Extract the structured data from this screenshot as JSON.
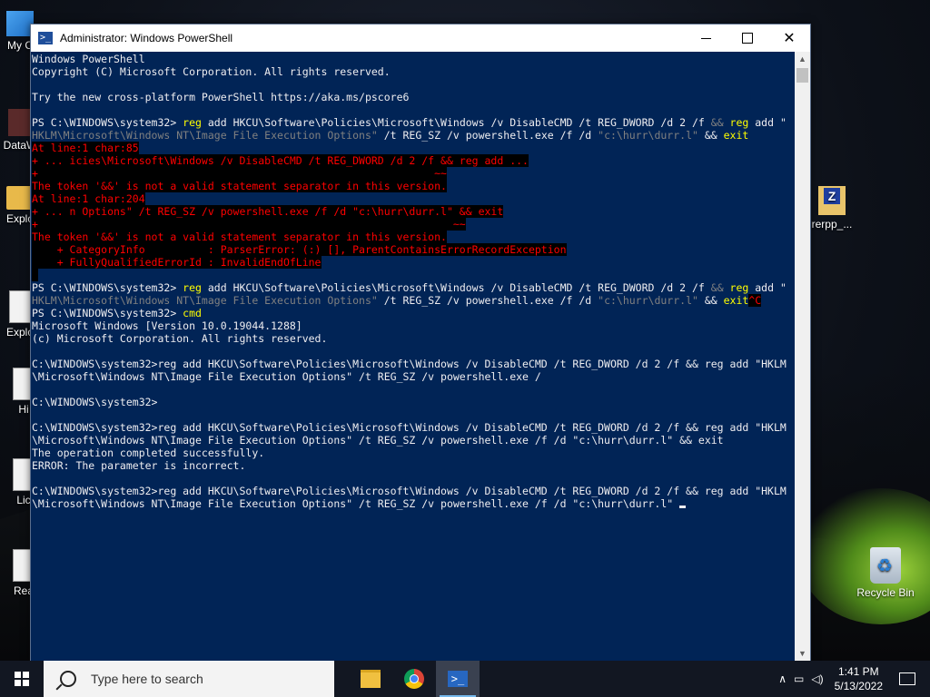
{
  "window": {
    "title": "Administrator: Windows PowerShell",
    "icon": "powershell-icon"
  },
  "console": {
    "lines": [
      [
        {
          "t": "Windows PowerShell",
          "c": "cmdcol"
        }
      ],
      [
        {
          "t": "Copyright (C) Microsoft Corporation. All rights reserved.",
          "c": "cmdcol"
        }
      ],
      [
        {
          "t": "",
          "c": "cmdcol"
        }
      ],
      [
        {
          "t": "Try the new cross-platform PowerShell https://aka.ms/pscore6",
          "c": "cmdcol"
        }
      ],
      [
        {
          "t": "",
          "c": "cmdcol"
        }
      ],
      [
        {
          "t": "PS C:\\WINDOWS\\system32> ",
          "c": "cmdcol"
        },
        {
          "t": "reg",
          "c": "yellow"
        },
        {
          "t": " add HKCU\\Software\\Policies\\Microsoft\\Windows /v DisableCMD /t REG_DWORD /d 2 /f ",
          "c": "cmdcol"
        },
        {
          "t": "&&",
          "c": "gray"
        },
        {
          "t": " reg",
          "c": "yellow"
        },
        {
          "t": " add \"",
          "c": "cmdcol"
        }
      ],
      [
        {
          "t": "HKLM\\Microsoft\\Windows NT\\Image File Execution Options\"",
          "c": "gray"
        },
        {
          "t": " /t REG_SZ /v powershell.exe /f /d ",
          "c": "cmdcol"
        },
        {
          "t": "\"c:\\hurr\\durr.l\"",
          "c": "gray"
        },
        {
          "t": " && ",
          "c": "cmdcol"
        },
        {
          "t": "exit",
          "c": "yellow"
        }
      ],
      [
        {
          "t": "At line:1 char:85",
          "c": "err"
        }
      ],
      [
        {
          "t": "+ ... icies\\Microsoft\\Windows /v DisableCMD /t REG_DWORD /d 2 /f && reg add ...",
          "c": "err"
        }
      ],
      [
        {
          "t": "+                                                               ~~",
          "c": "err"
        }
      ],
      [
        {
          "t": "The token '&&' is not a valid statement separator in this version.",
          "c": "err"
        }
      ],
      [
        {
          "t": "At line:1 char:204",
          "c": "err"
        }
      ],
      [
        {
          "t": "+ ... n Options\" /t REG_SZ /v powershell.exe /f /d \"c:\\hurr\\durr.l\" && exit",
          "c": "err"
        }
      ],
      [
        {
          "t": "+                                                                  ~~",
          "c": "err"
        }
      ],
      [
        {
          "t": "The token '&&' is not a valid statement separator in this version.",
          "c": "err"
        }
      ],
      [
        {
          "t": "    + CategoryInfo          : ParserError: (:) [], ParentContainsErrorRecordException",
          "c": "err"
        }
      ],
      [
        {
          "t": "    + FullyQualifiedErrorId : InvalidEndOfLine",
          "c": "err"
        }
      ],
      [
        {
          "t": " ",
          "c": "err"
        }
      ],
      [
        {
          "t": "PS C:\\WINDOWS\\system32> ",
          "c": "cmdcol"
        },
        {
          "t": "reg",
          "c": "yellow"
        },
        {
          "t": " add HKCU\\Software\\Policies\\Microsoft\\Windows /v DisableCMD /t REG_DWORD /d 2 /f ",
          "c": "cmdcol"
        },
        {
          "t": "&&",
          "c": "gray"
        },
        {
          "t": " reg",
          "c": "yellow"
        },
        {
          "t": " add \"",
          "c": "cmdcol"
        }
      ],
      [
        {
          "t": "HKLM\\Microsoft\\Windows NT\\Image File Execution Options\"",
          "c": "gray"
        },
        {
          "t": " /t REG_SZ /v powershell.exe /f /d ",
          "c": "cmdcol"
        },
        {
          "t": "\"c:\\hurr\\durr.l\"",
          "c": "gray"
        },
        {
          "t": " && ",
          "c": "cmdcol"
        },
        {
          "t": "exit",
          "c": "yellow"
        },
        {
          "t": "^C",
          "c": "err"
        }
      ],
      [
        {
          "t": "PS C:\\WINDOWS\\system32> ",
          "c": "cmdcol"
        },
        {
          "t": "cmd",
          "c": "yellow"
        }
      ],
      [
        {
          "t": "Microsoft Windows [Version 10.0.19044.1288]",
          "c": "cmdcol"
        }
      ],
      [
        {
          "t": "(c) Microsoft Corporation. All rights reserved.",
          "c": "cmdcol"
        }
      ],
      [
        {
          "t": "",
          "c": "cmdcol"
        }
      ],
      [
        {
          "t": "C:\\WINDOWS\\system32>reg add HKCU\\Software\\Policies\\Microsoft\\Windows /v DisableCMD /t REG_DWORD /d 2 /f && reg add \"HKLM",
          "c": "cmdcol"
        }
      ],
      [
        {
          "t": "\\Microsoft\\Windows NT\\Image File Execution Options\" /t REG_SZ /v powershell.exe /",
          "c": "cmdcol"
        }
      ],
      [
        {
          "t": "",
          "c": "cmdcol"
        }
      ],
      [
        {
          "t": "C:\\WINDOWS\\system32>",
          "c": "cmdcol"
        }
      ],
      [
        {
          "t": "",
          "c": "cmdcol"
        }
      ],
      [
        {
          "t": "C:\\WINDOWS\\system32>reg add HKCU\\Software\\Policies\\Microsoft\\Windows /v DisableCMD /t REG_DWORD /d 2 /f && reg add \"HKLM",
          "c": "cmdcol"
        }
      ],
      [
        {
          "t": "\\Microsoft\\Windows NT\\Image File Execution Options\" /t REG_SZ /v powershell.exe /f /d \"c:\\hurr\\durr.l\" && exit",
          "c": "cmdcol"
        }
      ],
      [
        {
          "t": "The operation completed successfully.",
          "c": "cmdcol"
        }
      ],
      [
        {
          "t": "ERROR: The parameter is incorrect.",
          "c": "cmdcol"
        }
      ],
      [
        {
          "t": "",
          "c": "cmdcol"
        }
      ],
      [
        {
          "t": "C:\\WINDOWS\\system32>reg add HKCU\\Software\\Policies\\Microsoft\\Windows /v DisableCMD /t REG_DWORD /d 2 /f && reg add \"HKLM",
          "c": "cmdcol"
        }
      ],
      [
        {
          "t": "\\Microsoft\\Windows NT\\Image File Execution Options\" /t REG_SZ /v powershell.exe /f /d \"c:\\hurr\\durr.l\" ",
          "c": "cmdcol"
        },
        {
          "t": "",
          "c": "cursor"
        }
      ]
    ]
  },
  "desktop": {
    "icons": [
      {
        "label": "My C",
        "name": "my-computer-icon"
      },
      {
        "label": "DataW",
        "name": "datawindow-icon"
      },
      {
        "label": "Explo",
        "name": "explorer-icon-1"
      },
      {
        "label": "Explo",
        "name": "explorer-icon-2"
      },
      {
        "label": "Hi",
        "name": "history-icon"
      },
      {
        "label": "Lic",
        "name": "license-icon"
      },
      {
        "label": "Rea",
        "name": "readme-icon"
      },
      {
        "label": "rerpp_...",
        "name": "rerpp-icon"
      },
      {
        "label": "Recycle Bin",
        "name": "recycle-bin-icon"
      }
    ]
  },
  "taskbar": {
    "search_placeholder": "Type here to search",
    "time": "1:41 PM",
    "date": "5/13/2022"
  },
  "colors": {
    "console_bg": "#012456",
    "console_fg": "#eeedf0",
    "error_fg": "#ff0000",
    "command_fg": "#ffff00"
  }
}
